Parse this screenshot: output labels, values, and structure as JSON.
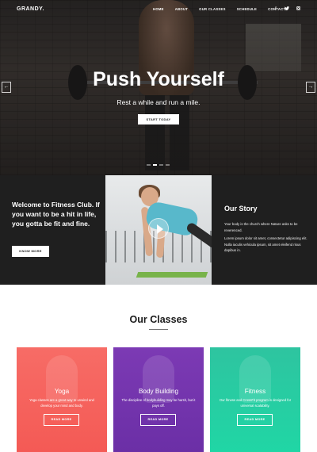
{
  "brand": {
    "logo": "GRANDY."
  },
  "nav": {
    "items": [
      "HOME",
      "ABOUT",
      "OUR CLASSES",
      "SCHEDULE",
      "CONTACT"
    ],
    "social": [
      "f",
      "t",
      "ig"
    ]
  },
  "hero": {
    "title": "Push Yourself",
    "subtitle": "Rest a while and run a mile.",
    "button": "START TODAY",
    "prev_arrow": "←",
    "next_arrow": "→"
  },
  "welcome": {
    "heading": "Welcome to Fitness Club. If you want to be a hit in life, you gotta be fit and fine.",
    "button": "KNOW MORE"
  },
  "story": {
    "heading": "Our Story",
    "lead": "Your body is the church where Nature asks to be reverenced.",
    "body": "Lorem ipsum dolor sit amet, consectetur adipiscing elit. Nulla iaculis vehicula ipsum, sit amet eleifend risus dapibus in."
  },
  "classes": {
    "title": "Our Classes",
    "cards": [
      {
        "title": "Yoga",
        "desc": "Yoga classes are a great way to unwind and develop your mind and body.",
        "button": "READ MORE"
      },
      {
        "title": "Body Building",
        "desc": "The discipline of bodybuilding may be harsh, but it pays off.",
        "button": "READ MORE"
      },
      {
        "title": "Fitness",
        "desc": "Our fitness and CrossFit program is designed for universal scalability.",
        "button": "READ MORE"
      }
    ]
  },
  "colors": {
    "yoga": "#f45a55",
    "bodybuilding": "#6b2fa6",
    "fitness": "#20d6a5",
    "dark_band": "#1f1f1f"
  }
}
